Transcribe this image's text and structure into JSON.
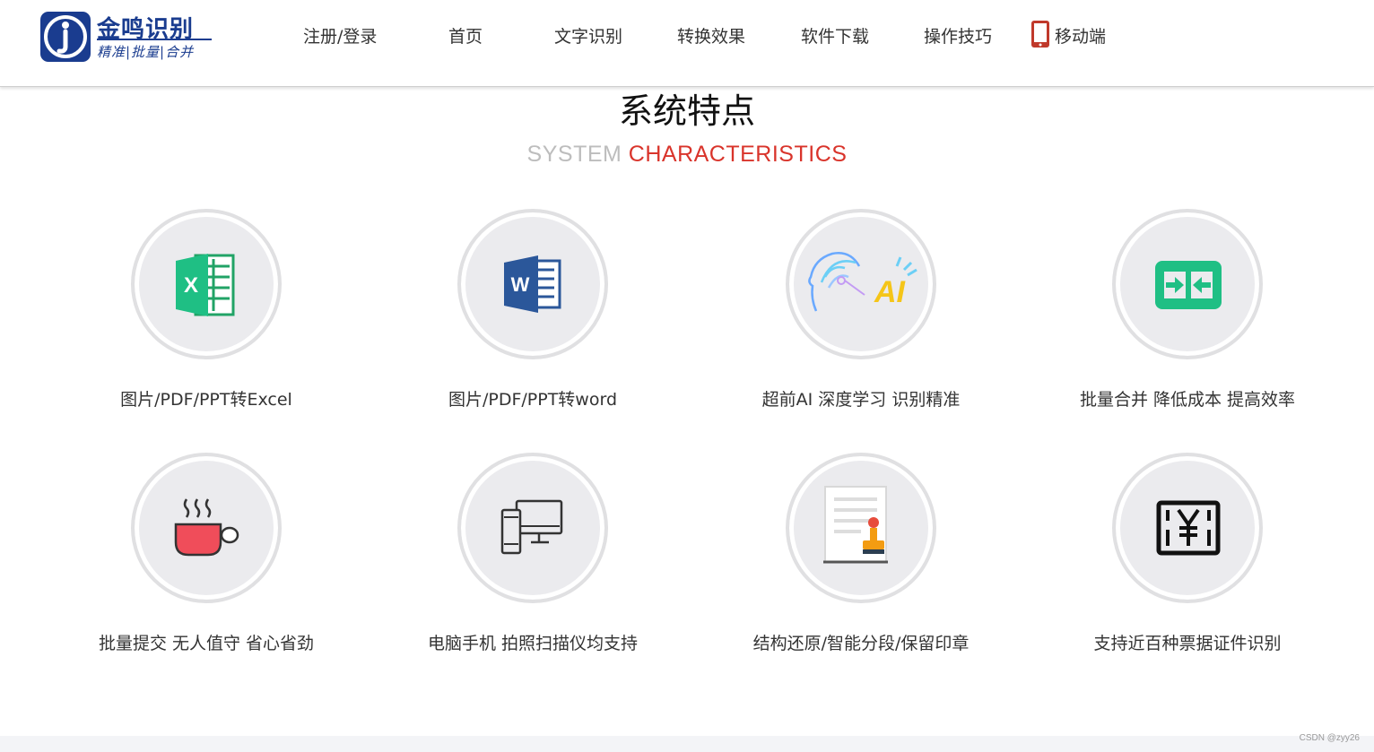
{
  "logo": {
    "title": "金鸣识别",
    "subtitle": "精准|批量|合并",
    "brand_color": "#1a3c8f"
  },
  "nav": {
    "items": [
      "注册/登录",
      "首页",
      "文字识别",
      "转换效果",
      "软件下载",
      "操作技巧"
    ],
    "mobile_label": "移动端",
    "mobile_icon": "mobile-phone-icon"
  },
  "section": {
    "title": "系统特点",
    "subtitle_part1": "SYSTEM",
    "subtitle_part2": "CHARACTERISTICS",
    "accent_color": "#d9342b"
  },
  "features": [
    {
      "label": "图片/PDF/PPT转Excel",
      "icon": "excel-icon"
    },
    {
      "label": "图片/PDF/PPT转word",
      "icon": "word-icon"
    },
    {
      "label": "超前AI 深度学习 识别精准",
      "icon": "ai-head-icon"
    },
    {
      "label": "批量合并 降低成本 提高效率",
      "icon": "merge-arrows-icon"
    },
    {
      "label": "批量提交 无人值守 省心省劲",
      "icon": "coffee-cup-icon"
    },
    {
      "label": "电脑手机 拍照扫描仪均支持",
      "icon": "devices-icon"
    },
    {
      "label": "结构还原/智能分段/保留印章",
      "icon": "document-stamp-icon"
    },
    {
      "label": "支持近百种票据证件识别",
      "icon": "yuan-invoice-icon"
    }
  ],
  "watermark": "CSDN @zyy26"
}
